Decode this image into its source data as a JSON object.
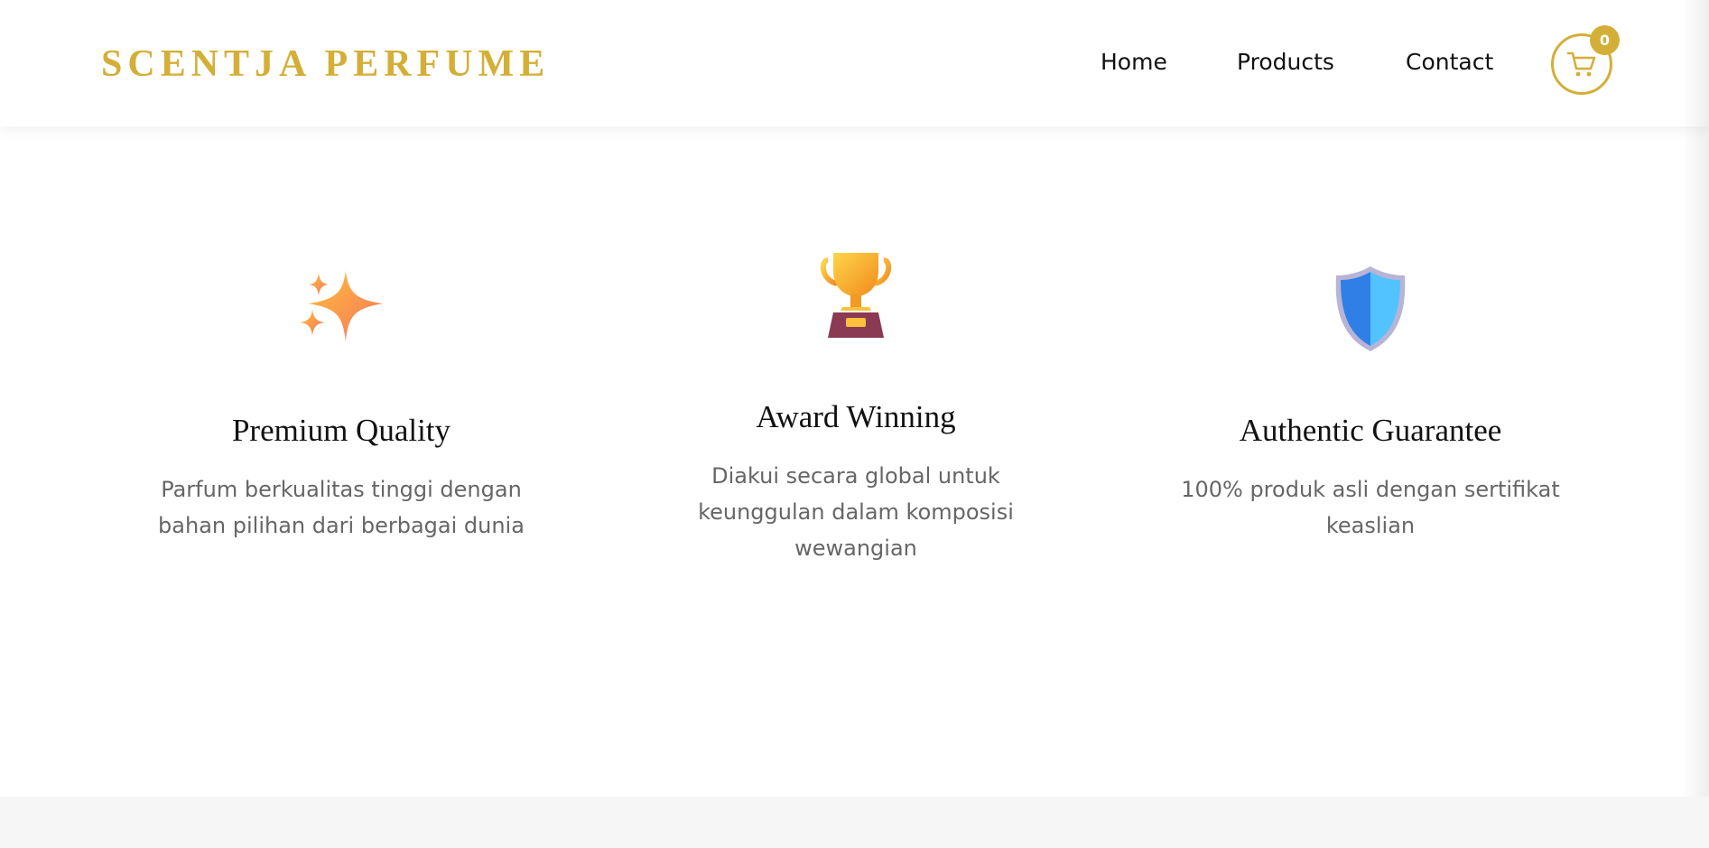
{
  "brand": {
    "name": "SCENTJA PERFUME",
    "color": "#D4AF37"
  },
  "nav": {
    "items": [
      {
        "label": "Home"
      },
      {
        "label": "Products"
      },
      {
        "label": "Contact"
      }
    ]
  },
  "cart": {
    "icon": "shopping-cart-icon",
    "count": "0",
    "accent": "#D4AF37"
  },
  "features": [
    {
      "icon": "sparkles-icon",
      "title": "Premium Quality",
      "description": "Parfum berkualitas tinggi dengan bahan pilihan dari berbagai dunia"
    },
    {
      "icon": "trophy-icon",
      "title": "Award Winning",
      "description": "Diakui secara global untuk keunggulan dalam komposisi wewangian"
    },
    {
      "icon": "shield-icon",
      "title": "Authentic Guarantee",
      "description": "100% produk asli dengan sertifikat keaslian"
    }
  ],
  "colors": {
    "text_dark": "#111111",
    "text_muted": "#666666",
    "footer_band": "#F6F6F6"
  }
}
